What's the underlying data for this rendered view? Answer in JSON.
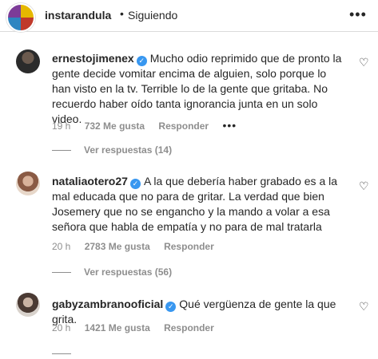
{
  "header": {
    "username": "instarandula",
    "separator": "•",
    "follow_status": "Siguiendo",
    "more_icon": "more-horizontal-icon"
  },
  "comments": [
    {
      "username": "ernestojimenex",
      "text": "Mucho odio reprimido que de pronto la gente decide vomitar encima de alguien, solo porque lo han visto en la tv. Terrible lo de la gente que gritaba. No recuerdo haber oído tanta ignorancia junta en un solo video.",
      "time": "19 h",
      "likes": "732 Me gusta",
      "reply": "Responder",
      "replies": "Ver respuestas (14)"
    },
    {
      "username": "nataliaotero27",
      "text": "A la que debería haber grabado es a la mal educada que no para de gritar. La verdad que bien Josemery que no se engancho y la mando a volar a esa señora que habla de empatía y no para de mal tratarla",
      "time": "20 h",
      "likes": "2783 Me gusta",
      "reply": "Responder",
      "replies": "Ver respuestas (56)"
    },
    {
      "username": "gabyzambranooficial",
      "text": "Qué vergüenza de gente la que grita.",
      "time": "20 h",
      "likes": "1421 Me gusta",
      "reply": "Responder",
      "replies": ""
    }
  ],
  "colors": {
    "verified": "#3897f0",
    "muted": "#8e8e8e",
    "text": "#262626"
  }
}
